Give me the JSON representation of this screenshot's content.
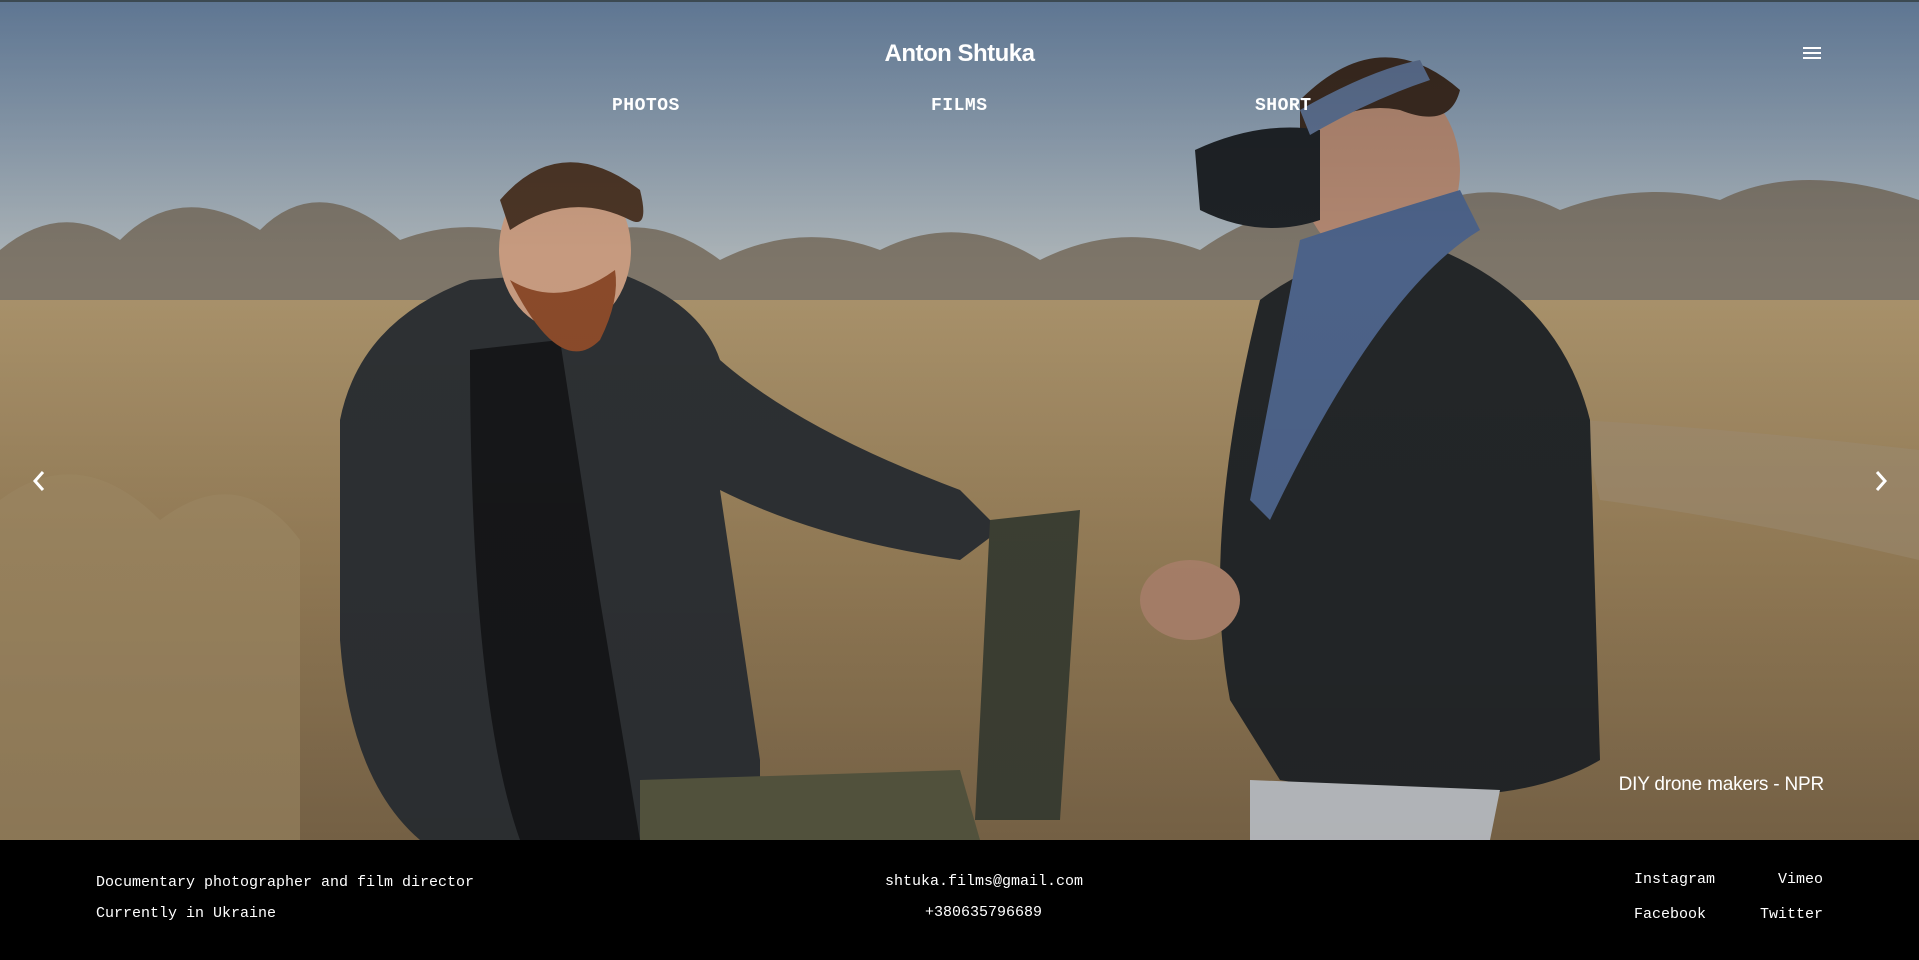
{
  "site": {
    "title": "Anton Shtuka"
  },
  "nav": {
    "items": [
      {
        "label": "PHOTOS"
      },
      {
        "label": "FILMS"
      },
      {
        "label": "SHORT"
      }
    ]
  },
  "slide": {
    "caption": "DIY drone makers - NPR"
  },
  "icons": {
    "menu": "hamburger-menu-icon",
    "prev": "chevron-left-icon",
    "next": "chevron-right-icon"
  },
  "footer": {
    "bio_line1": "Documentary photographer and film director",
    "bio_line2": "Currently in Ukraine",
    "email": "shtuka.films@gmail.com",
    "phone": "+380635796689",
    "social": [
      {
        "label": "Instagram"
      },
      {
        "label": "Vimeo"
      },
      {
        "label": "Facebook"
      },
      {
        "label": "Twitter"
      }
    ]
  },
  "colors": {
    "footer_bg": "#000000",
    "text": "#ffffff"
  }
}
